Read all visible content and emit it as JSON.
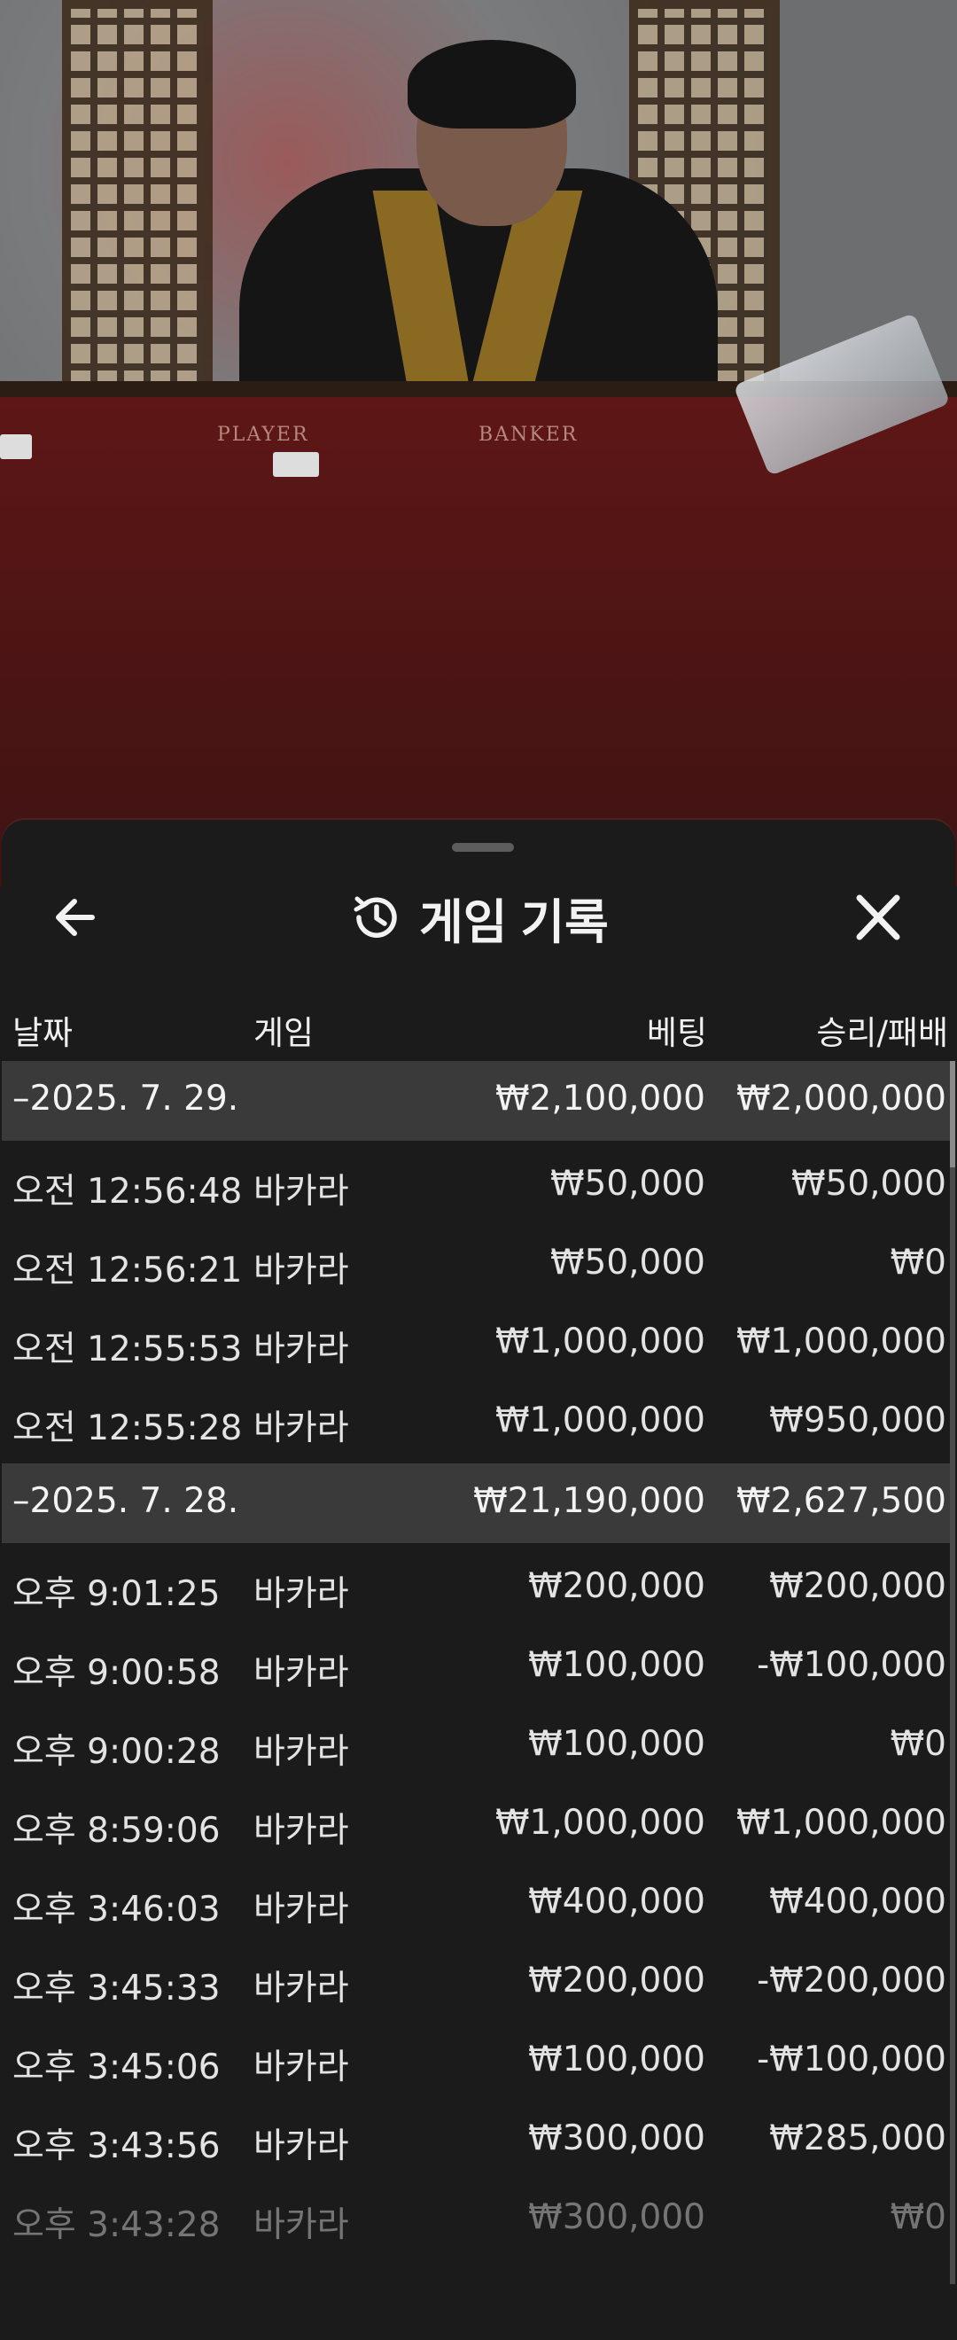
{
  "scene": {
    "table_labels": {
      "player": "PLAYER",
      "banker": "BANKER"
    }
  },
  "sheet": {
    "title": "게임 기록",
    "icons": {
      "back": "arrow-left-icon",
      "history": "history-icon",
      "close": "close-icon"
    }
  },
  "columns": {
    "date": "날짜",
    "game": "게임",
    "bet": "베팅",
    "result": "승리/패배"
  },
  "groups": [
    {
      "date": "–2025. 7. 29.",
      "bet_total": "₩2,100,000",
      "result_total": "₩2,000,000",
      "rows": [
        {
          "time": "오전 12:56:48",
          "game": "바카라",
          "bet": "₩50,000",
          "result": "₩50,000"
        },
        {
          "time": "오전 12:56:21",
          "game": "바카라",
          "bet": "₩50,000",
          "result": "₩0"
        },
        {
          "time": "오전 12:55:53",
          "game": "바카라",
          "bet": "₩1,000,000",
          "result": "₩1,000,000"
        },
        {
          "time": "오전 12:55:28",
          "game": "바카라",
          "bet": "₩1,000,000",
          "result": "₩950,000"
        }
      ]
    },
    {
      "date": "–2025. 7. 28.",
      "bet_total": "₩21,190,000",
      "result_total": "₩2,627,500",
      "rows": [
        {
          "time": "오후 9:01:25",
          "game": "바카라",
          "bet": "₩200,000",
          "result": "₩200,000"
        },
        {
          "time": "오후 9:00:58",
          "game": "바카라",
          "bet": "₩100,000",
          "result": "-₩100,000"
        },
        {
          "time": "오후 9:00:28",
          "game": "바카라",
          "bet": "₩100,000",
          "result": "₩0"
        },
        {
          "time": "오후 8:59:06",
          "game": "바카라",
          "bet": "₩1,000,000",
          "result": "₩1,000,000"
        },
        {
          "time": "오후 3:46:03",
          "game": "바카라",
          "bet": "₩400,000",
          "result": "₩400,000"
        },
        {
          "time": "오후 3:45:33",
          "game": "바카라",
          "bet": "₩200,000",
          "result": "-₩200,000"
        },
        {
          "time": "오후 3:45:06",
          "game": "바카라",
          "bet": "₩100,000",
          "result": "-₩100,000"
        },
        {
          "time": "오후 3:43:56",
          "game": "바카라",
          "bet": "₩300,000",
          "result": "₩285,000"
        },
        {
          "time": "오후 3:43:28",
          "game": "바카라",
          "bet": "₩300,000",
          "result": "₩0"
        }
      ]
    }
  ]
}
